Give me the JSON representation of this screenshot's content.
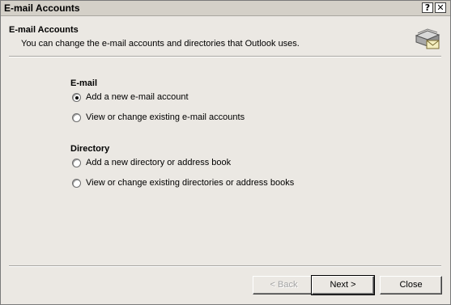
{
  "window": {
    "title": "E-mail Accounts",
    "help_button": "?",
    "close_button": "✕"
  },
  "header": {
    "title": "E-mail Accounts",
    "subtitle": "You can change the e-mail accounts and directories that Outlook uses.",
    "icon": "mail-accounts-icon"
  },
  "email_group": {
    "title": "E-mail",
    "options": [
      {
        "label": "Add a new e-mail account",
        "checked": true
      },
      {
        "label": "View or change existing e-mail accounts",
        "checked": false
      }
    ]
  },
  "directory_group": {
    "title": "Directory",
    "options": [
      {
        "label": "Add a new directory or address book",
        "checked": false
      },
      {
        "label": "View or change existing directories or address books",
        "checked": false
      }
    ]
  },
  "buttons": {
    "back": "< Back",
    "next": "Next >",
    "close": "Close"
  },
  "colors": {
    "dialog_bg": "#ebe8e3",
    "titlebar_bg": "#d4d0c8"
  }
}
